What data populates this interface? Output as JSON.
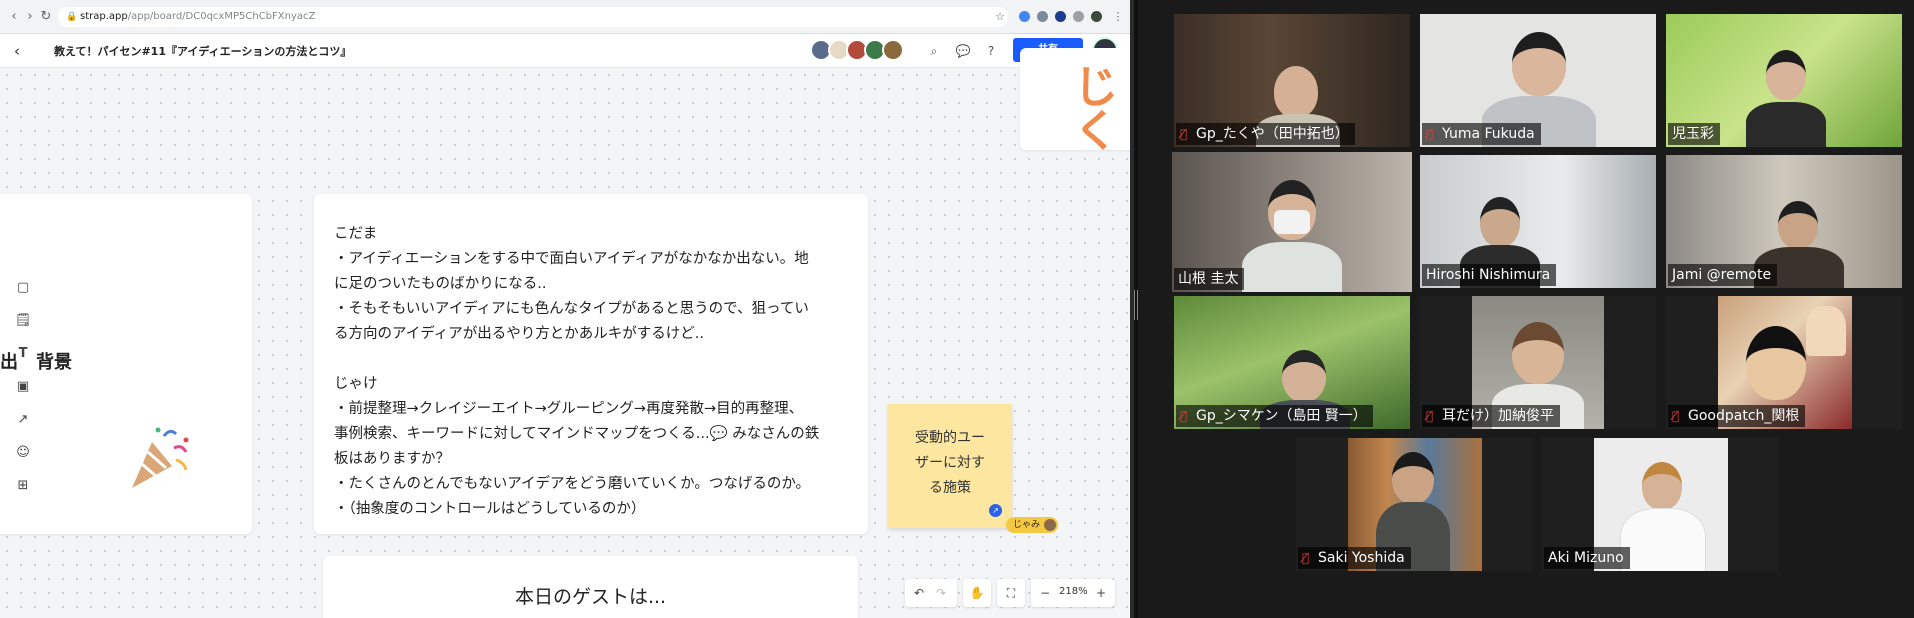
{
  "browser": {
    "url_host": "strap.app",
    "url_path": "/app/board/DC0qcxMP5ChCbFXnyacZ",
    "nav": [
      "‹",
      "›",
      "↻"
    ]
  },
  "app_bar": {
    "title": "教えて！パイセン#11『アイディエーションの方法とコツ』",
    "share_label": "共有"
  },
  "canvas": {
    "left_card_title": "出　背景",
    "top_right_text": "じく",
    "main_card_text": "こだま\n・アイディエーションをする中で面白いアイディアがなかなか出ない。地\nに足のついたものばかりになる..\n・そもそもいいアイディアにも色んなタイプがあると思うので、狙ってい\nる方向のアイディアが出るやり方とかあルキがするけど..\n\nじゃけ\n・前提整理→クレイジーエイト→グルーピング→再度発散→目的再整理、\n事例検索、キーワードに対してマインドマップをつくる...💬 みなさんの鉄\n板はありますか？\n・たくさんのとんでもないアイデアをどう磨いていくか。つなげるのか。\n・（抽象度のコントロールはどうしているのか）",
    "sticky_text_lines": [
      "受動的ユー",
      "ザーに対す",
      "る施策"
    ],
    "cursor_label": "じゃみ",
    "guest_card_text": "本日のゲストは..."
  },
  "toolbar": {
    "zoom": "218%",
    "zoom_minus": "−",
    "zoom_plus": "+"
  },
  "colors": {
    "share_button": "#1a5cff",
    "sticky_note": "#fde7a0",
    "active_speaker": "#d6e38a",
    "accent_orange": "#f08a4b"
  },
  "participants": [
    {
      "name": "Gp_たくや（田中拓也）",
      "muted": true
    },
    {
      "name": "Yuma Fukuda",
      "muted": true
    },
    {
      "name": "児玉彩",
      "muted": false
    },
    {
      "name": "山根 圭太",
      "muted": false,
      "active": true
    },
    {
      "name": "Hiroshi Nishimura",
      "muted": false
    },
    {
      "name": "Jami @remote",
      "muted": false
    },
    {
      "name": "Gp_シマケン（島田 賢一）",
      "muted": true
    },
    {
      "name": "耳だけ）加納俊平",
      "muted": true
    },
    {
      "name": "Goodpatch_関根",
      "muted": true
    },
    {
      "name": "Saki Yoshida",
      "muted": true
    },
    {
      "name": "Aki Mizuno",
      "muted": false
    }
  ],
  "icons": {
    "mute": "muted-mic-icon"
  }
}
